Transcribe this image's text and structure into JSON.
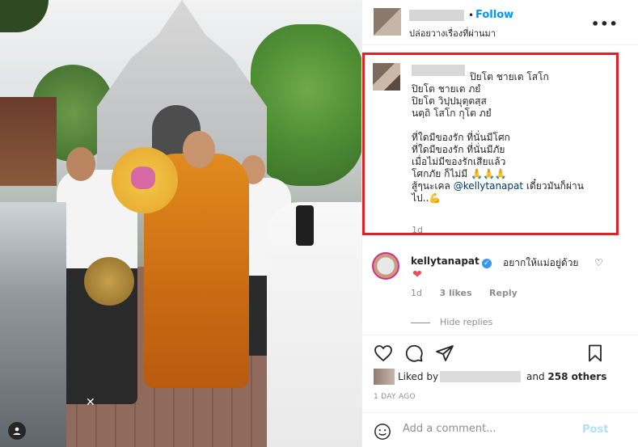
{
  "header": {
    "follow_label": "Follow",
    "location": "ปล่อยวางเรื่องที่ผ่านมา",
    "more_label": "•••"
  },
  "comment": {
    "lines": [
      "ปิยโต ชายเต โสโก",
      "ปิยโต ชายเต ภยํ",
      "ปิยโต วิปฺปมุตฺตสฺส",
      "นตฺถิ โสโก กุโต ภยํ",
      "",
      "ที่ใดมีของรัก ที่นั่นมีโศก",
      "ที่ใดมีของรัก ที่นั่นมีภัย",
      "เมื่อไม่มีของรักเสียแล้ว",
      "โศกภัย ก็ไม่มี 🙏🙏🙏",
      "สู้ๆนะเคล ",
      "ไป..💪"
    ],
    "mention": "@kellytanapat",
    "mention_tail": " เดี๋ยวมันก็ผ่าน",
    "time": "1d"
  },
  "reply": {
    "username": "kellytanapat",
    "verified_mark": "✓",
    "text": "อยากให้แม่อยู่ด้วย",
    "heart": "❤",
    "like_icon": "♡",
    "time": "1d",
    "likes": "3 likes",
    "reply_label": "Reply"
  },
  "hide_replies": "Hide replies",
  "likes": {
    "prefix": "Liked by",
    "and_label": "and",
    "others": "258 others"
  },
  "date": "1 DAY AGO",
  "add_comment": {
    "placeholder": "Add a comment...",
    "post_label": "Post"
  },
  "photo": {
    "sparkle": "✕"
  }
}
